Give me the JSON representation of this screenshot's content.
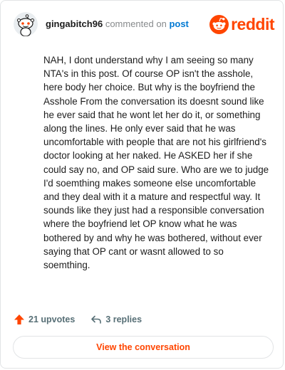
{
  "header": {
    "username": "gingabitch96",
    "action_text": "commented on",
    "post_link_label": "post",
    "brand_name": "reddit",
    "avatar_icon": "snoo-avatar-icon",
    "brand_icon": "reddit-alien-icon"
  },
  "comment": {
    "body": "NAH, I dont understand why I am seeing so many NTA's in this post. Of course OP isn't the asshole, here body her choice. But why is the boyfriend the Asshole From the conversation its doesnt sound like he ever said that he wont let her do it, or something along the lines. He only ever said that he was uncomfortable with people that are not his girlfriend's doctor looking at her naked. He ASKED her if she could say no, and OP said sure. Who are we to judge I'd soemthing makes someone else uncomfortable and they deal with it a mature and respectful way. It sounds like they just had a responsible conversation where the boyfriend let OP know what he was bothered by and why he was bothered, without ever saying that OP cant or wasnt allowed to so soemthing."
  },
  "meta": {
    "upvotes_label": "21 upvotes",
    "replies_label": "3 replies",
    "upvote_icon": "upvote-arrow-icon",
    "reply_icon": "reply-arrow-icon"
  },
  "cta": {
    "label": "View the conversation"
  },
  "colors": {
    "brand": "#ff4500",
    "link": "#0079d3",
    "muted": "#878a8c",
    "meta": "#576f76",
    "text": "#1c1c1c",
    "border": "#e2e4e6"
  }
}
